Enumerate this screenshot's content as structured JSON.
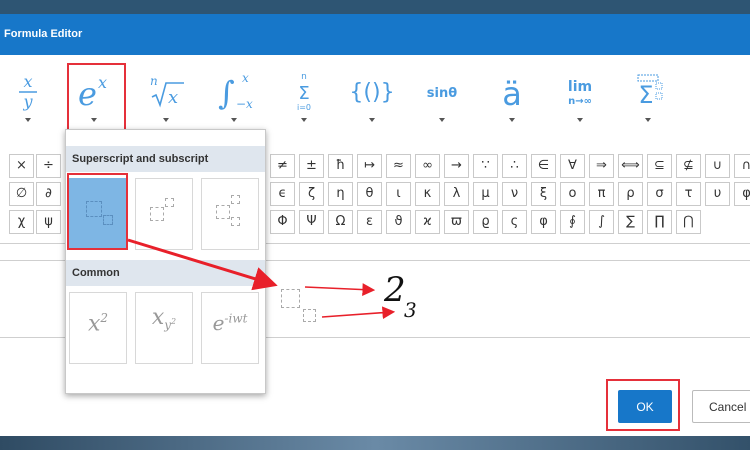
{
  "dialog": {
    "title": "Formula Editor"
  },
  "toolbar": {
    "buttons": [
      {
        "name": "fraction",
        "icon": "fraction-icon",
        "glyph": "x/y"
      },
      {
        "name": "superscript-subscript",
        "icon": "superscript-icon",
        "glyph": "e^x"
      },
      {
        "name": "radical",
        "icon": "radical-icon",
        "glyph": "ⁿ√x"
      },
      {
        "name": "integral",
        "icon": "integral-icon",
        "glyph": "∫"
      },
      {
        "name": "large-operator",
        "icon": "sum-icon",
        "glyph": "Σ"
      },
      {
        "name": "bracket",
        "icon": "bracket-icon",
        "glyph": "{()}"
      },
      {
        "name": "function",
        "icon": "function-icon",
        "glyph": "sinθ"
      },
      {
        "name": "accent",
        "icon": "accent-icon",
        "glyph": "ä"
      },
      {
        "name": "limit-log",
        "icon": "limit-icon",
        "glyph": "lim n→∞"
      },
      {
        "name": "operator",
        "icon": "operator-icon",
        "glyph": "Σ"
      }
    ]
  },
  "symbols": {
    "row1_left": [
      "×",
      "÷"
    ],
    "row2_left": [
      "∅",
      "∂"
    ],
    "row3_left": [
      "χ",
      "ψ"
    ],
    "row1_right": [
      "≠",
      "±",
      "ħ",
      "↦",
      "≈",
      "∞",
      "→",
      "∵",
      "∴",
      "∈",
      "∀",
      "⇒",
      "⟺",
      "⊆",
      "⊈",
      "∪",
      "∩"
    ],
    "row2_right": [
      "ϵ",
      "ζ",
      "η",
      "θ",
      "ι",
      "κ",
      "λ",
      "μ",
      "ν",
      "ξ",
      "ο",
      "π",
      "ρ",
      "σ",
      "τ",
      "υ",
      "φ"
    ],
    "row3_right": [
      "Φ",
      "Ψ",
      "Ω",
      "ε",
      "ϑ",
      "ϰ",
      "ϖ",
      "ϱ",
      "ς",
      "φ",
      "∮",
      "∫",
      "∑",
      "∏",
      "⋂"
    ]
  },
  "popup": {
    "section1_label": "Superscript and subscript",
    "section2_label": "Common",
    "common_items": [
      {
        "base": "x",
        "sup": "2"
      },
      {
        "base": "x",
        "sub": "y",
        "subsup": "2"
      },
      {
        "base": "e",
        "sup": "-iwt"
      }
    ]
  },
  "editor": {
    "result_base": "2",
    "result_sub": "3"
  },
  "buttons": {
    "ok_label": "OK",
    "cancel_label": "Cancel"
  },
  "colors": {
    "accent": "#1777c9",
    "highlight": "#e5303a",
    "icon_blue": "#4a9be0",
    "selected_tile": "#7eb6e4"
  }
}
